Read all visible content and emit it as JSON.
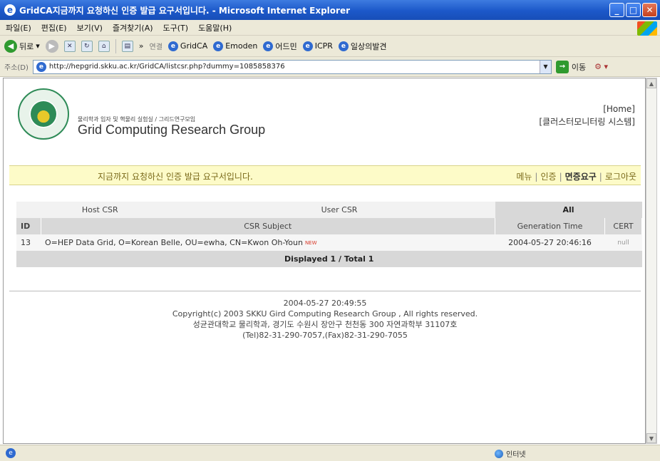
{
  "window": {
    "title": "GridCA지금까지 요청하신 인증 발급 요구서입니다. - Microsoft Internet Explorer",
    "controls": [
      "_",
      "□",
      "✕"
    ]
  },
  "menu": [
    "파일(E)",
    "편집(E)",
    "보기(V)",
    "즐겨찾기(A)",
    "도구(T)",
    "도움말(H)"
  ],
  "toolbar": {
    "back": "뒤로",
    "links_label": "연결",
    "links": [
      "GridCA",
      "Emoden",
      "어드민",
      "ICPR",
      "일상의발견"
    ]
  },
  "address": {
    "label": "주소(D)",
    "url": "http://hepgrid.skku.ac.kr/GridCA/listcsr.php?dummy=1085858376",
    "go": "이동"
  },
  "page": {
    "logo_subtitle": "물리학과 입자 및 핵물리 실험실 / 그리드연구모임",
    "logo_title": "Grid Computing Research Group",
    "home": "[Home]",
    "monitoring": "[클러스터모니터링 시스템]",
    "banner_text": "지금까지 요청하신 인증 발급 요구서입니다.",
    "nav": [
      "메뉴",
      "인증",
      "면증요구",
      "로그아웃"
    ],
    "tabs": [
      "Host CSR",
      "User CSR",
      "All"
    ],
    "columns": [
      "ID",
      "CSR Subject",
      "Generation Time",
      "CERT"
    ],
    "rows": [
      {
        "id": "13",
        "subject": "O=HEP Data Grid, O=Korean Belle, OU=ewha, CN=Kwon Oh-Youn",
        "tag": "NEW",
        "time": "2004-05-27 20:46:16",
        "cert": "null"
      }
    ],
    "total": "Displayed 1 / Total 1",
    "footer": {
      "datetime": "2004-05-27 20:49:55",
      "copyright": "Copyright(c) 2003 SKKU Gird Computing Research Group , All rights reserved.",
      "address": "성균관대학교 물리학과, 경기도 수원시 장안구 천천동 300 자연과학부 31107호",
      "contact": "(Tel)82-31-290-7057,(Fax)82-31-290-7055"
    }
  },
  "status": {
    "zone": "인터넷"
  }
}
